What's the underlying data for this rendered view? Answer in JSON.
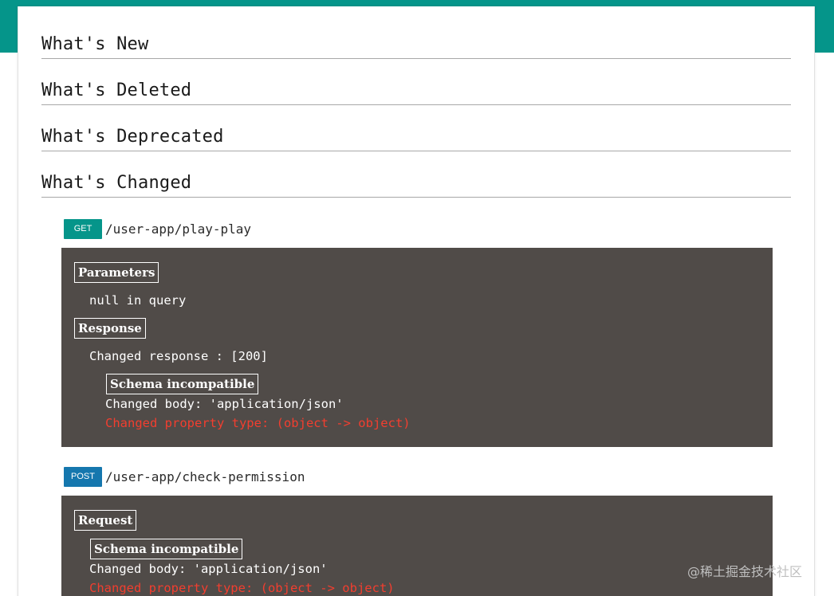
{
  "sections": {
    "whats_new": "What's New",
    "whats_deleted": "What's Deleted",
    "whats_deprecated": "What's Deprecated",
    "whats_changed": "What's Changed"
  },
  "endpoints": [
    {
      "method": "GET",
      "path": "/user-app/play-play",
      "details": {
        "parameters_label": "Parameters",
        "parameters_text": "null in query",
        "response_label": "Response",
        "response_text": "Changed response : [200]",
        "schema_label": "Schema incompatible",
        "body_text": "Changed body: 'application/json'",
        "property_text": "Changed property type: (object -> object)"
      }
    },
    {
      "method": "POST",
      "path": "/user-app/check-permission",
      "details": {
        "request_label": "Request",
        "schema_label": "Schema incompatible",
        "body_text": "Changed body: 'application/json'",
        "property_text": "Changed property type: (object -> object)"
      }
    }
  ],
  "watermark": "@稀土掘金技术社区",
  "colors": {
    "accent_teal": "#05958a",
    "post_blue": "#1577ae",
    "panel_bg": "#504b48",
    "change_red": "#f23e2f"
  }
}
